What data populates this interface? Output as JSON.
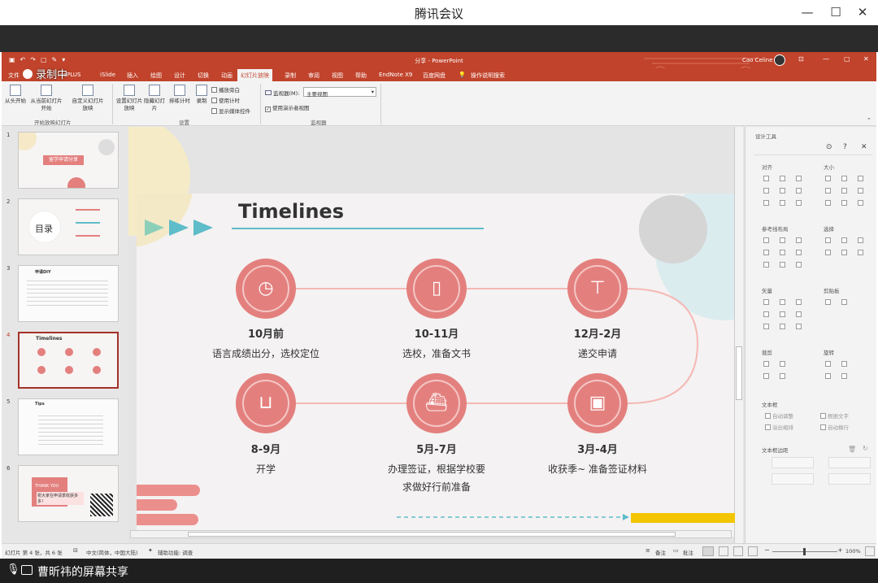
{
  "window": {
    "title": "腾讯会议"
  },
  "ppt": {
    "title": "分享 - PowerPoint",
    "user": "Cao Celine",
    "recording_label": "录制中",
    "tabs": [
      "文件",
      "cePLUS",
      "iSlide",
      "插入",
      "绘图",
      "设计",
      "切换",
      "动画",
      "幻灯片放映",
      "录制",
      "审阅",
      "视图",
      "帮助",
      "EndNote X9",
      "百度网盘",
      "操作说明搜索"
    ],
    "active_tab": "幻灯片放映",
    "ribbon": {
      "btn_from_start": "从头开始",
      "btn_from_current": "从当前幻灯片开始",
      "btn_custom_show": "自定义幻灯片放映",
      "group_start": "开始放映幻灯片",
      "btn_setup": "设置幻灯片放映",
      "btn_hide": "隐藏幻灯片",
      "btn_rehearse": "排练计时",
      "btn_record": "录制",
      "chk_narration": "播放旁白",
      "chk_timing": "使用计时",
      "chk_media": "显示媒体控件",
      "group_setup": "设置",
      "monitor_label": "监视器(M):",
      "monitor_value": "主要视图",
      "chk_presenter": "使用演示者视图",
      "group_monitor": "监视器"
    }
  },
  "thumbnails": [
    {
      "num": "1",
      "title": "留学申请分享"
    },
    {
      "num": "2",
      "title": "目录"
    },
    {
      "num": "3",
      "title": "申请DIY"
    },
    {
      "num": "4",
      "title": "Timelines"
    },
    {
      "num": "5",
      "title": "Tips"
    },
    {
      "num": "6",
      "title": "THANK YOU",
      "sub": "祝大家在申请季收获多多！"
    }
  ],
  "slide": {
    "title": "Timelines",
    "milestones": [
      {
        "date": "10月前",
        "desc": "语言成绩出分，选校定位",
        "icon": "clock-icon"
      },
      {
        "date": "10-11月",
        "desc": "选校，准备文书",
        "icon": "battery-icon"
      },
      {
        "date": "12月-2月",
        "desc": "递交申请",
        "icon": "signpost-icon"
      },
      {
        "date": "8-9月",
        "desc": "开学",
        "icon": "cart-icon"
      },
      {
        "date": "5月-7月",
        "desc": "办理签证，根据学校要求做好行前准备",
        "desc_line1": "办理签证，根据学校要",
        "desc_line2": "求做好行前准备",
        "icon": "ship-icon"
      },
      {
        "date": "3月-4月",
        "desc": "收获季~ 准备签证材料",
        "icon": "gift-icon"
      }
    ]
  },
  "design_pane": {
    "title": "设计工具",
    "sec_align": "对齐",
    "sec_size": "大小",
    "sec_guides": "参考线布局",
    "sec_select": "选择",
    "sec_vector": "矢量",
    "sec_clipboard": "剪贴板",
    "sec_cut": "裁剪",
    "sec_rotate": "旋转",
    "sec_textbox": "文本框",
    "opt_autofit": "自动调整",
    "opt_wrap": "溢出缩排",
    "opt_fit_text": "根据文字",
    "opt_autowrap": "自动换行",
    "sec_margins": "文本框边距"
  },
  "status": {
    "slide_info": "幻灯片 第 4 张，共 6 张",
    "language": "中文(简体，中国大陆)",
    "accessibility": "辅助功能: 调查",
    "notes": "备注",
    "comments": "批注",
    "zoom": "100%"
  },
  "meeting": {
    "share_label": "曹昕祎的屏幕共享"
  },
  "colors": {
    "ppt_red": "#c1432b",
    "circle_pink": "#e3807e",
    "line_pink": "#f5b8b5",
    "teal": "#5fbcc9",
    "yellow": "#f2c500"
  }
}
